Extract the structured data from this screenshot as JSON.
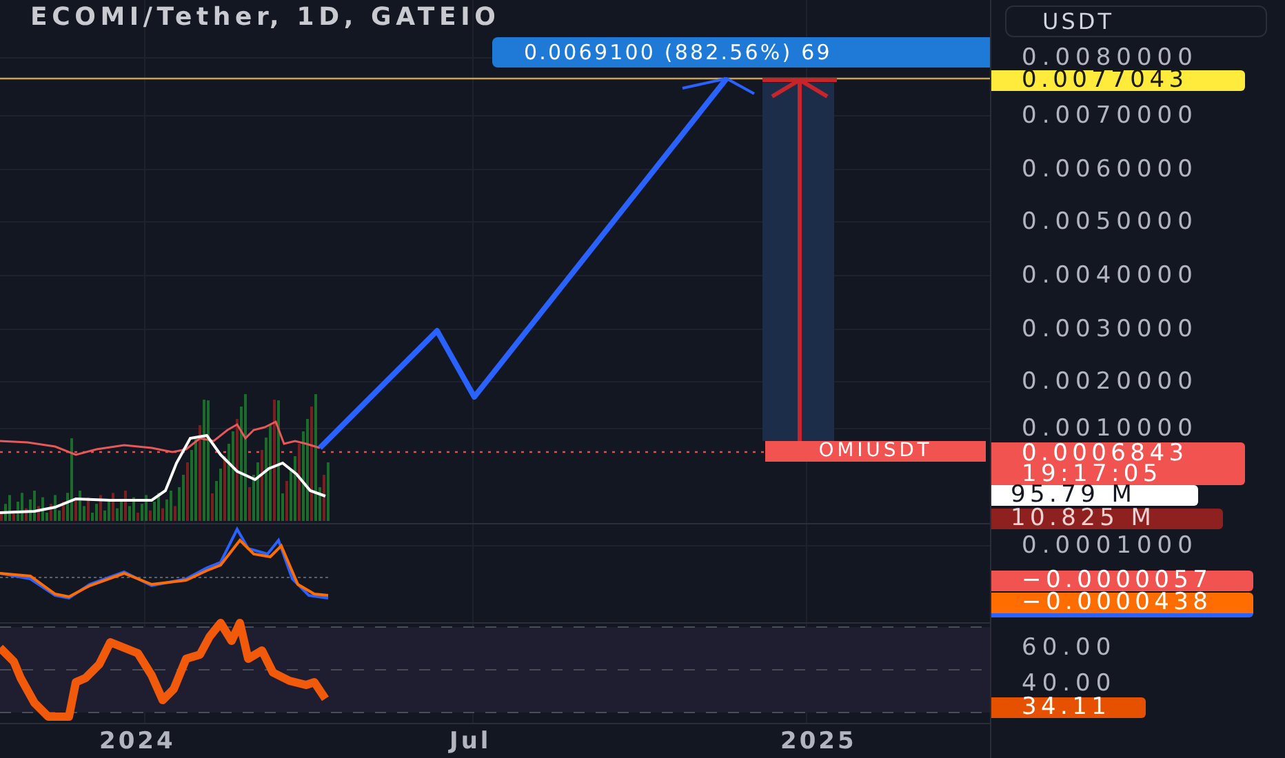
{
  "title": "ECOMI/Tether, 1D, GATEIO",
  "currency": "USDT",
  "measure_label": "0.0069100 (882.56%) 69",
  "symbol_tag": "OMIUSDT",
  "price_ticks": [
    "0.0080000",
    "0.0070000",
    "0.0060000",
    "0.0050000",
    "0.0040000",
    "0.0030000",
    "0.0020000",
    "0.0010000",
    "0.0001000"
  ],
  "tags": [
    {
      "kind": "target",
      "text": "0.0077043"
    },
    {
      "kind": "last",
      "text": "0.0006843",
      "sub": "19:17:05"
    },
    {
      "kind": "volume",
      "text": "95.79 M"
    },
    {
      "kind": "volume-ma",
      "text": "10.825 M"
    },
    {
      "kind": "macd",
      "text": "−0.0000057"
    },
    {
      "kind": "signal",
      "text": "−0.0000438"
    },
    {
      "kind": "rsi",
      "text": "34.11"
    }
  ],
  "rsi_ticks": [
    "60.00",
    "40.00"
  ],
  "time_ticks": [
    "2024",
    "Jul",
    "2025"
  ]
}
